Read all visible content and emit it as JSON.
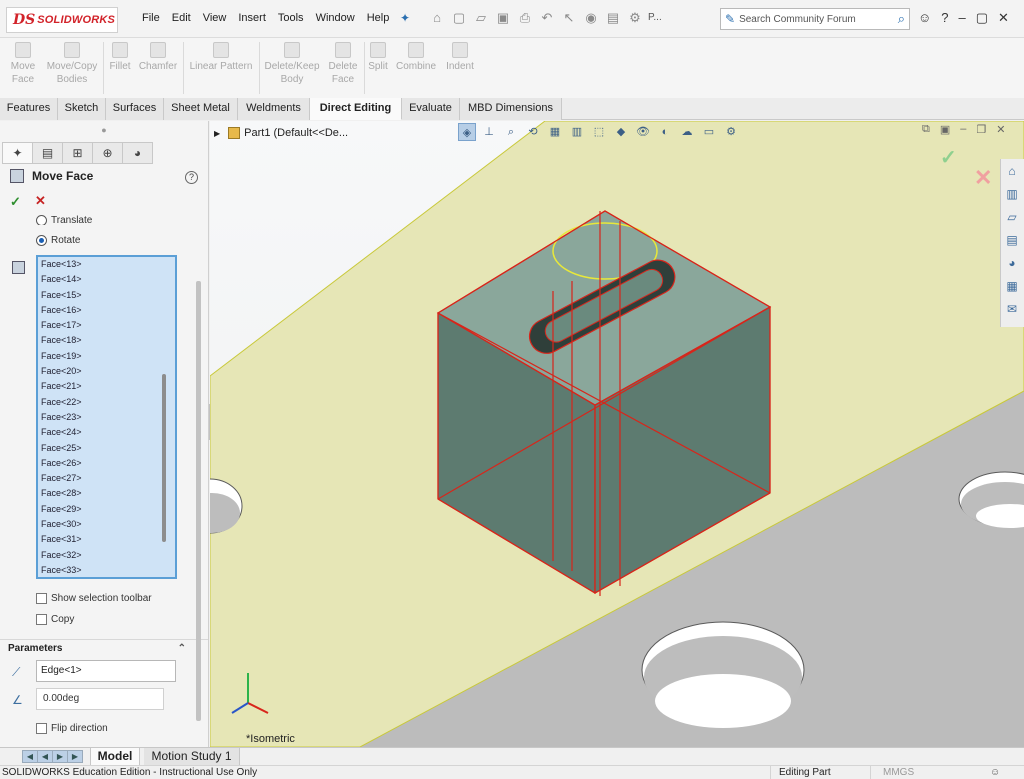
{
  "app": {
    "logo_ds": "DS",
    "logo_name": "SOLIDWORKS",
    "menus": [
      "File",
      "Edit",
      "View",
      "Insert",
      "Tools",
      "Window",
      "Help"
    ],
    "quick_tail": "P...",
    "search_placeholder": "Search Community Forum",
    "help_label": "?"
  },
  "command_manager": {
    "buttons": [
      {
        "label": "Move Face",
        "icon": "move-face-icon"
      },
      {
        "label": "Move/Copy Bodies",
        "icon": "move-copy-bodies-icon"
      },
      {
        "label": "Fillet",
        "icon": "fillet-icon"
      },
      {
        "label": "Chamfer",
        "icon": "chamfer-icon"
      },
      {
        "label": "Linear Pattern",
        "icon": "linear-pattern-icon"
      },
      {
        "label": "Delete/Keep Body",
        "icon": "delete-keep-body-icon"
      },
      {
        "label": "Delete Face",
        "icon": "delete-face-icon"
      },
      {
        "label": "Split",
        "icon": "split-icon"
      },
      {
        "label": "Combine",
        "icon": "combine-icon"
      },
      {
        "label": "Indent",
        "icon": "indent-icon"
      }
    ]
  },
  "tabs": {
    "items": [
      "Features",
      "Sketch",
      "Surfaces",
      "Sheet Metal",
      "Weldments",
      "Direct Editing",
      "Evaluate",
      "MBD Dimensions"
    ],
    "active": "Direct Editing"
  },
  "property_manager": {
    "title": "Move Face",
    "help": "?",
    "ok": "✓",
    "cancel": "✕",
    "options": [
      {
        "label": "Translate",
        "selected": false
      },
      {
        "label": "Rotate",
        "selected": true
      }
    ],
    "faces": [
      "Face<13>",
      "Face<14>",
      "Face<15>",
      "Face<16>",
      "Face<17>",
      "Face<18>",
      "Face<19>",
      "Face<20>",
      "Face<21>",
      "Face<22>",
      "Face<23>",
      "Face<24>",
      "Face<25>",
      "Face<26>",
      "Face<27>",
      "Face<28>",
      "Face<29>",
      "Face<30>",
      "Face<31>",
      "Face<32>",
      "Face<33>"
    ],
    "show_selection_toolbar": "Show selection toolbar",
    "copy": "Copy",
    "parameters_title": "Parameters",
    "axis_edge": "Edge<1>",
    "angle": "0.00deg",
    "flip_direction": "Flip direction"
  },
  "viewport": {
    "tree_root": "Part1  (Default<<De...",
    "view_label": "*Isometric",
    "colors": {
      "plate_top": "#e6e6b6",
      "plate_side": "#bcbcbc",
      "block": "#5d7b70",
      "block_light": "#8aa79b",
      "edges": "#d8251a",
      "selection": "#e8e83a"
    }
  },
  "bottom": {
    "model_tab": "Model",
    "motion_tab": "Motion Study 1"
  },
  "status": {
    "left": "SOLIDWORKS Education Edition - Instructional Use Only",
    "mode": "Editing Part",
    "units": "MMGS"
  }
}
